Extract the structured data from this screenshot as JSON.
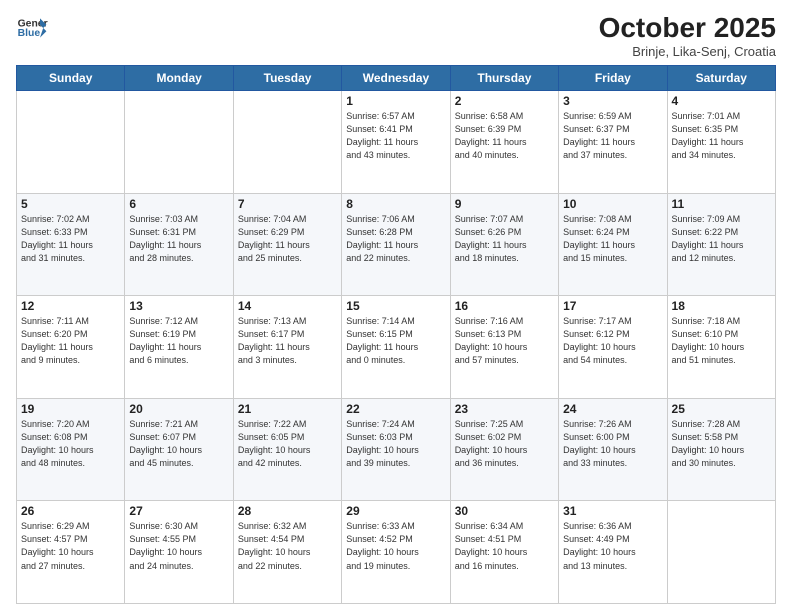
{
  "header": {
    "logo_line1": "General",
    "logo_line2": "Blue",
    "month": "October 2025",
    "location": "Brinje, Lika-Senj, Croatia"
  },
  "weekdays": [
    "Sunday",
    "Monday",
    "Tuesday",
    "Wednesday",
    "Thursday",
    "Friday",
    "Saturday"
  ],
  "weeks": [
    [
      {
        "day": "",
        "info": ""
      },
      {
        "day": "",
        "info": ""
      },
      {
        "day": "",
        "info": ""
      },
      {
        "day": "1",
        "info": "Sunrise: 6:57 AM\nSunset: 6:41 PM\nDaylight: 11 hours\nand 43 minutes."
      },
      {
        "day": "2",
        "info": "Sunrise: 6:58 AM\nSunset: 6:39 PM\nDaylight: 11 hours\nand 40 minutes."
      },
      {
        "day": "3",
        "info": "Sunrise: 6:59 AM\nSunset: 6:37 PM\nDaylight: 11 hours\nand 37 minutes."
      },
      {
        "day": "4",
        "info": "Sunrise: 7:01 AM\nSunset: 6:35 PM\nDaylight: 11 hours\nand 34 minutes."
      }
    ],
    [
      {
        "day": "5",
        "info": "Sunrise: 7:02 AM\nSunset: 6:33 PM\nDaylight: 11 hours\nand 31 minutes."
      },
      {
        "day": "6",
        "info": "Sunrise: 7:03 AM\nSunset: 6:31 PM\nDaylight: 11 hours\nand 28 minutes."
      },
      {
        "day": "7",
        "info": "Sunrise: 7:04 AM\nSunset: 6:29 PM\nDaylight: 11 hours\nand 25 minutes."
      },
      {
        "day": "8",
        "info": "Sunrise: 7:06 AM\nSunset: 6:28 PM\nDaylight: 11 hours\nand 22 minutes."
      },
      {
        "day": "9",
        "info": "Sunrise: 7:07 AM\nSunset: 6:26 PM\nDaylight: 11 hours\nand 18 minutes."
      },
      {
        "day": "10",
        "info": "Sunrise: 7:08 AM\nSunset: 6:24 PM\nDaylight: 11 hours\nand 15 minutes."
      },
      {
        "day": "11",
        "info": "Sunrise: 7:09 AM\nSunset: 6:22 PM\nDaylight: 11 hours\nand 12 minutes."
      }
    ],
    [
      {
        "day": "12",
        "info": "Sunrise: 7:11 AM\nSunset: 6:20 PM\nDaylight: 11 hours\nand 9 minutes."
      },
      {
        "day": "13",
        "info": "Sunrise: 7:12 AM\nSunset: 6:19 PM\nDaylight: 11 hours\nand 6 minutes."
      },
      {
        "day": "14",
        "info": "Sunrise: 7:13 AM\nSunset: 6:17 PM\nDaylight: 11 hours\nand 3 minutes."
      },
      {
        "day": "15",
        "info": "Sunrise: 7:14 AM\nSunset: 6:15 PM\nDaylight: 11 hours\nand 0 minutes."
      },
      {
        "day": "16",
        "info": "Sunrise: 7:16 AM\nSunset: 6:13 PM\nDaylight: 10 hours\nand 57 minutes."
      },
      {
        "day": "17",
        "info": "Sunrise: 7:17 AM\nSunset: 6:12 PM\nDaylight: 10 hours\nand 54 minutes."
      },
      {
        "day": "18",
        "info": "Sunrise: 7:18 AM\nSunset: 6:10 PM\nDaylight: 10 hours\nand 51 minutes."
      }
    ],
    [
      {
        "day": "19",
        "info": "Sunrise: 7:20 AM\nSunset: 6:08 PM\nDaylight: 10 hours\nand 48 minutes."
      },
      {
        "day": "20",
        "info": "Sunrise: 7:21 AM\nSunset: 6:07 PM\nDaylight: 10 hours\nand 45 minutes."
      },
      {
        "day": "21",
        "info": "Sunrise: 7:22 AM\nSunset: 6:05 PM\nDaylight: 10 hours\nand 42 minutes."
      },
      {
        "day": "22",
        "info": "Sunrise: 7:24 AM\nSunset: 6:03 PM\nDaylight: 10 hours\nand 39 minutes."
      },
      {
        "day": "23",
        "info": "Sunrise: 7:25 AM\nSunset: 6:02 PM\nDaylight: 10 hours\nand 36 minutes."
      },
      {
        "day": "24",
        "info": "Sunrise: 7:26 AM\nSunset: 6:00 PM\nDaylight: 10 hours\nand 33 minutes."
      },
      {
        "day": "25",
        "info": "Sunrise: 7:28 AM\nSunset: 5:58 PM\nDaylight: 10 hours\nand 30 minutes."
      }
    ],
    [
      {
        "day": "26",
        "info": "Sunrise: 6:29 AM\nSunset: 4:57 PM\nDaylight: 10 hours\nand 27 minutes."
      },
      {
        "day": "27",
        "info": "Sunrise: 6:30 AM\nSunset: 4:55 PM\nDaylight: 10 hours\nand 24 minutes."
      },
      {
        "day": "28",
        "info": "Sunrise: 6:32 AM\nSunset: 4:54 PM\nDaylight: 10 hours\nand 22 minutes."
      },
      {
        "day": "29",
        "info": "Sunrise: 6:33 AM\nSunset: 4:52 PM\nDaylight: 10 hours\nand 19 minutes."
      },
      {
        "day": "30",
        "info": "Sunrise: 6:34 AM\nSunset: 4:51 PM\nDaylight: 10 hours\nand 16 minutes."
      },
      {
        "day": "31",
        "info": "Sunrise: 6:36 AM\nSunset: 4:49 PM\nDaylight: 10 hours\nand 13 minutes."
      },
      {
        "day": "",
        "info": ""
      }
    ]
  ]
}
